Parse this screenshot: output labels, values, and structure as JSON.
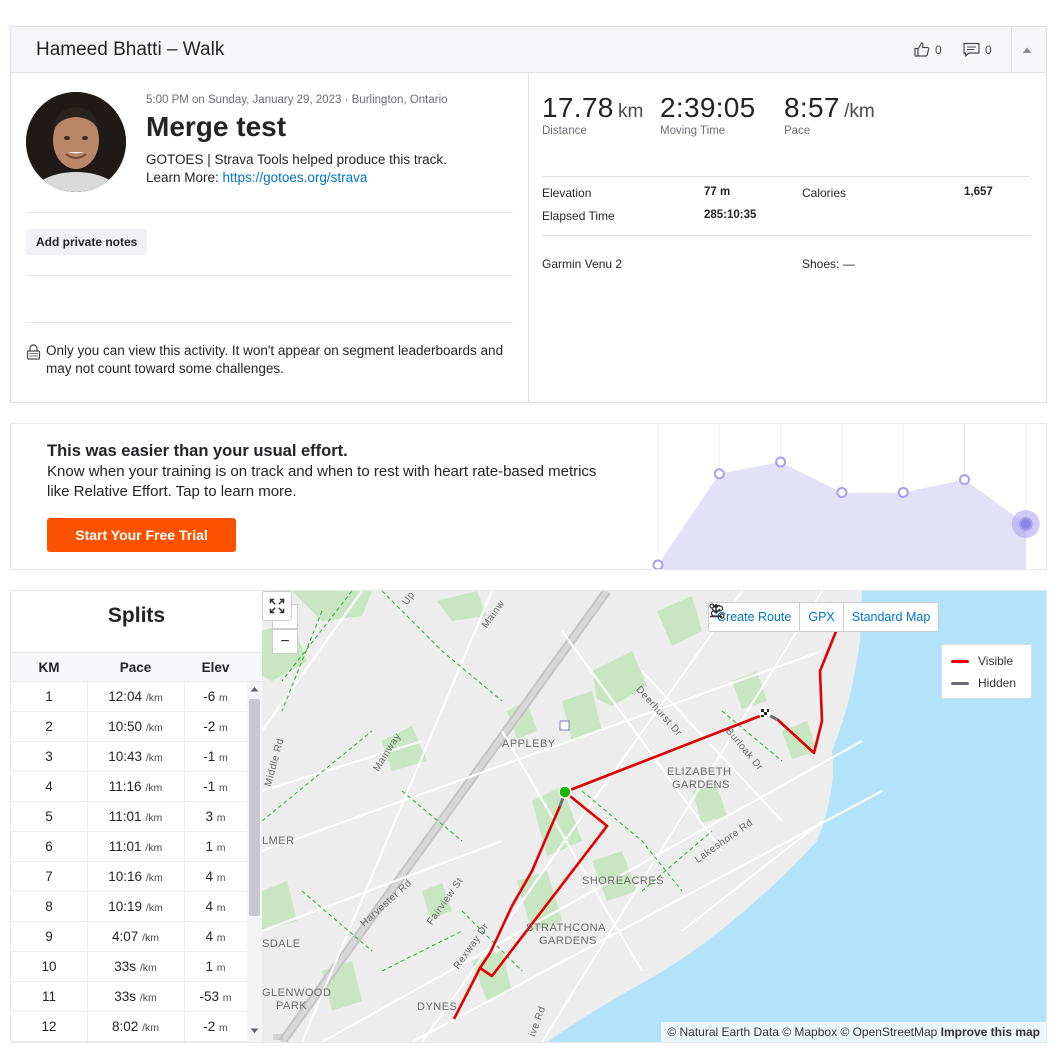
{
  "header": {
    "title": "Hameed Bhatti – Walk",
    "kudos_count": "0",
    "comment_count": "0"
  },
  "activity": {
    "date_location": "5:00 PM on Sunday, January 29, 2023 · Burlington, Ontario",
    "name": "Merge test",
    "description_line1": "GOTOES | Strava Tools helped produce this track.",
    "description_prefix": "Learn More: ",
    "description_link": "https://gotoes.org/strava",
    "private_notes_label": "Add private notes",
    "privacy_text": "Only you can view this activity. It won't appear on segment leaderboards and may not count toward some challenges."
  },
  "stats": {
    "distance": {
      "value": "17.78",
      "unit": "km",
      "label": "Distance"
    },
    "moving_time": {
      "value": "2:39:05",
      "label": "Moving Time"
    },
    "pace": {
      "value": "8:57",
      "unit": "/km",
      "label": "Pace"
    },
    "elevation_label": "Elevation",
    "elevation_value": "77 m",
    "calories_label": "Calories",
    "calories_value": "1,657",
    "elapsed_label": "Elapsed Time",
    "elapsed_value": "285:10:35",
    "device": "Garmin Venu 2",
    "shoes": "Shoes: —"
  },
  "upsell": {
    "title": "This was easier than your usual effort.",
    "body": "Know when your training is on track and when to rest with heart rate-based metrics like Relative Effort. Tap to learn more.",
    "button": "Start Your Free Trial",
    "effort_points": [
      0.0,
      0.78,
      0.88,
      0.62,
      0.62,
      0.73,
      0.35
    ],
    "colors": {
      "fill": "#e3e1f7",
      "point": "#a79ff0",
      "highlight": "#8f84e8",
      "button": "#fc5200"
    }
  },
  "splits": {
    "title": "Splits",
    "headers": {
      "km": "KM",
      "pace": "Pace",
      "elev": "Elev"
    },
    "pace_unit": "/km",
    "elev_unit": "m",
    "rows": [
      {
        "km": "1",
        "pace": "12:04",
        "elev": "-6"
      },
      {
        "km": "2",
        "pace": "10:50",
        "elev": "-2"
      },
      {
        "km": "3",
        "pace": "10:43",
        "elev": "-1"
      },
      {
        "km": "4",
        "pace": "11:16",
        "elev": "-1"
      },
      {
        "km": "5",
        "pace": "11:01",
        "elev": "3"
      },
      {
        "km": "6",
        "pace": "11:01",
        "elev": "1"
      },
      {
        "km": "7",
        "pace": "10:16",
        "elev": "4"
      },
      {
        "km": "8",
        "pace": "10:19",
        "elev": "4"
      },
      {
        "km": "9",
        "pace": "4:07",
        "elev": "4"
      },
      {
        "km": "10",
        "pace": "33s",
        "elev": "1"
      },
      {
        "km": "11",
        "pace": "33s",
        "elev": "-53"
      },
      {
        "km": "12",
        "pace": "8:02",
        "elev": "-2"
      }
    ]
  },
  "map": {
    "zoom_in": "+",
    "zoom_out": "−",
    "create_route": "Create Route",
    "gpx": "GPX",
    "map_style": "Standard Map",
    "legend_visible": "Visible",
    "legend_hidden": "Hidden",
    "attribution": "© Natural Earth Data © Mapbox © OpenStreetMap ",
    "improve": "Improve this map",
    "labels": {
      "appleby": "APPLEBY",
      "elizabeth1": "ELIZABETH",
      "elizabeth2": "GARDENS",
      "shoreacres": "SHOREACRES",
      "strathcona1": "STRATHCONA",
      "strathcona2": "GARDENS",
      "glenwood1": "GLENWOOD",
      "glenwood2": "PARK",
      "dynes": "DYNES",
      "elmer": "LMER",
      "sdale": "SDALE",
      "mainway1": "Mainway",
      "mainway2": "Mainw",
      "harvester": "Harvester Rd",
      "fairview": "Fairview St",
      "rexway": "Rexway Dr",
      "deerhurst": "Deerhurst Dr",
      "burloak": "Burloak Dr",
      "lakeshore": "Lakeshore Rd",
      "middle": "Middle Rd",
      "up": "Up",
      "ive": "ive Rd",
      "ze": "ze"
    },
    "colors": {
      "visible": "#e00000",
      "hidden": "#6d6d78",
      "water": "#b3e3fb",
      "park": "#c8e6c2",
      "land": "#ededed",
      "start": "#19b500"
    }
  }
}
